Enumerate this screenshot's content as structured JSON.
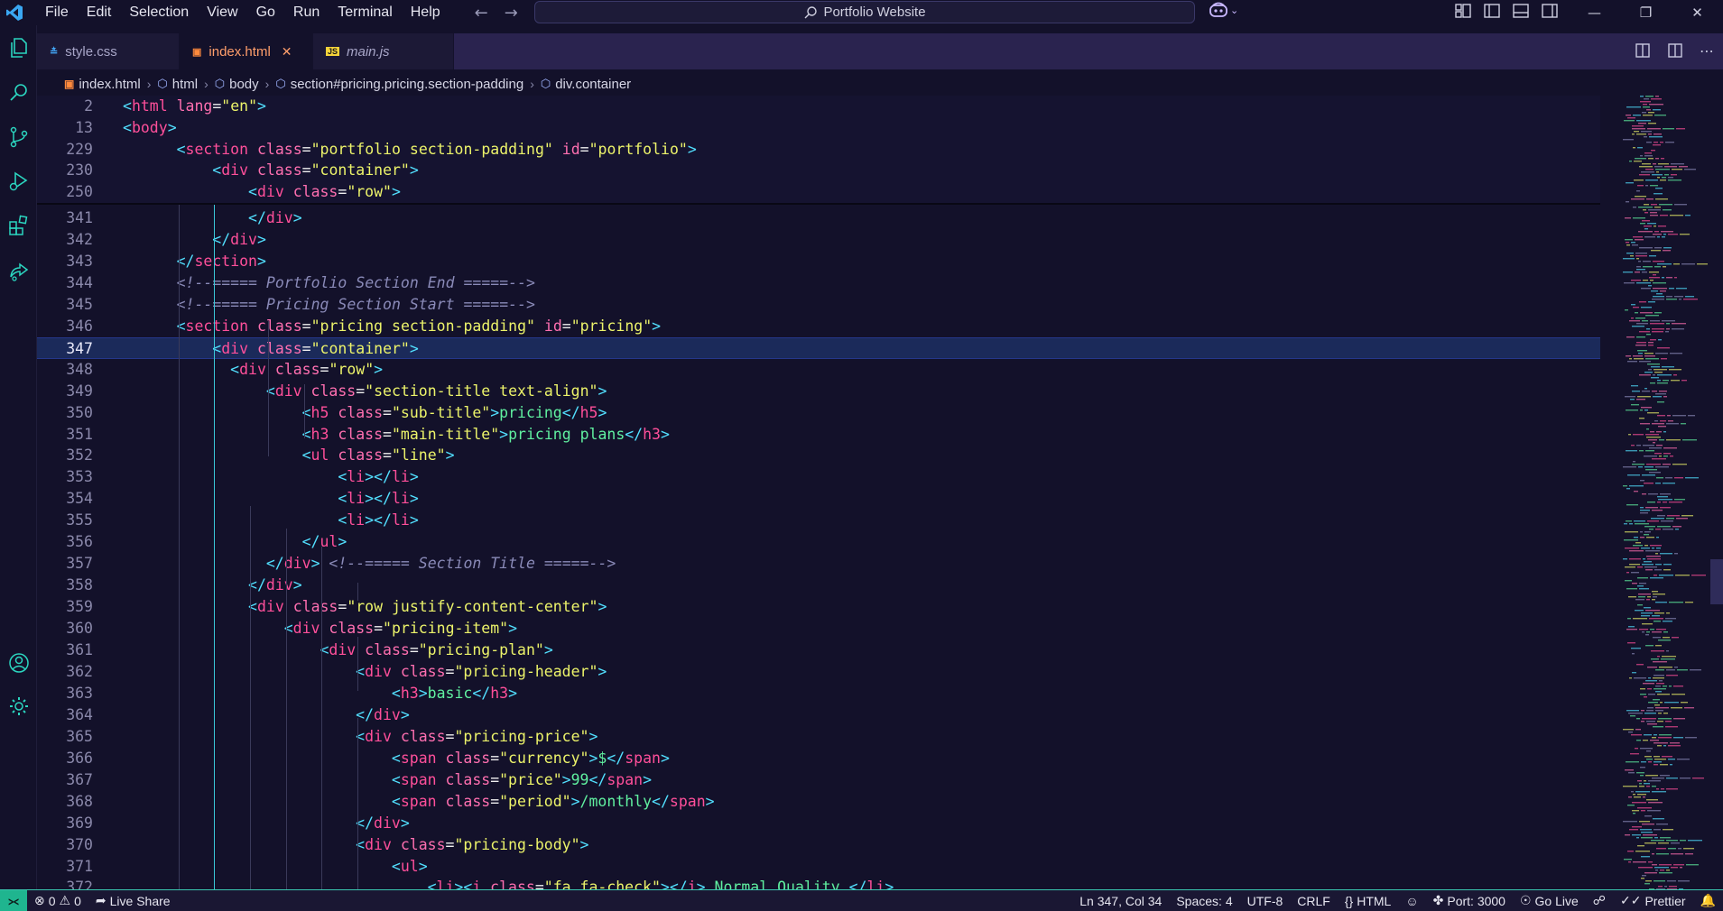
{
  "menu": [
    "File",
    "Edit",
    "Selection",
    "View",
    "Go",
    "Run",
    "Terminal",
    "Help"
  ],
  "command_center": {
    "label": "Portfolio Website"
  },
  "tabs": [
    {
      "label": "style.css",
      "icon": "css-file-icon",
      "active": false,
      "italic": false
    },
    {
      "label": "index.html",
      "icon": "html-file-icon",
      "active": true,
      "italic": false
    },
    {
      "label": "main.js",
      "icon": "js-file-icon",
      "active": false,
      "italic": true
    }
  ],
  "breadcrumb": [
    "index.html",
    "html",
    "body",
    "section#pricing.pricing.section-padding",
    "div.container"
  ],
  "sticky_lines": [
    {
      "n": "2",
      "indent": 0,
      "tokens": [
        [
          "t-punct",
          "<"
        ],
        [
          "t-tag",
          "html"
        ],
        [
          "t-attr",
          " lang"
        ],
        [
          "t-eq",
          "="
        ],
        [
          "t-str",
          "\"en\""
        ],
        [
          "t-punct",
          ">"
        ]
      ]
    },
    {
      "n": "13",
      "indent": 0,
      "tokens": [
        [
          "t-punct",
          "<"
        ],
        [
          "t-tag",
          "body"
        ],
        [
          "t-punct",
          ">"
        ]
      ]
    },
    {
      "n": "229",
      "indent": 6,
      "tokens": [
        [
          "t-punct",
          "<"
        ],
        [
          "t-tag",
          "section"
        ],
        [
          "t-attr",
          " class"
        ],
        [
          "t-eq",
          "="
        ],
        [
          "t-str",
          "\"portfolio section-padding\""
        ],
        [
          "t-attr",
          " id"
        ],
        [
          "t-eq",
          "="
        ],
        [
          "t-str",
          "\"portfolio\""
        ],
        [
          "t-punct",
          ">"
        ]
      ]
    },
    {
      "n": "230",
      "indent": 10,
      "tokens": [
        [
          "t-punct",
          "<"
        ],
        [
          "t-tag",
          "div"
        ],
        [
          "t-attr",
          " class"
        ],
        [
          "t-eq",
          "="
        ],
        [
          "t-str",
          "\"container\""
        ],
        [
          "t-punct",
          ">"
        ]
      ]
    },
    {
      "n": "250",
      "indent": 14,
      "tokens": [
        [
          "t-punct",
          "<"
        ],
        [
          "t-tag",
          "div"
        ],
        [
          "t-attr",
          " class"
        ],
        [
          "t-eq",
          "="
        ],
        [
          "t-str",
          "\"row\""
        ],
        [
          "t-punct",
          ">"
        ]
      ]
    }
  ],
  "lines": [
    {
      "n": "341",
      "indent": 14,
      "tokens": [
        [
          "t-punct",
          "</"
        ],
        [
          "t-tag",
          "div"
        ],
        [
          "t-punct",
          ">"
        ]
      ]
    },
    {
      "n": "342",
      "indent": 10,
      "tokens": [
        [
          "t-punct",
          "</"
        ],
        [
          "t-tag",
          "div"
        ],
        [
          "t-punct",
          ">"
        ]
      ]
    },
    {
      "n": "343",
      "indent": 6,
      "tokens": [
        [
          "t-punct",
          "</"
        ],
        [
          "t-tag",
          "section"
        ],
        [
          "t-punct",
          ">"
        ]
      ]
    },
    {
      "n": "344",
      "indent": 6,
      "tokens": [
        [
          "t-com",
          "<!--===== Portfolio Section End =====-->"
        ]
      ]
    },
    {
      "n": "345",
      "indent": 6,
      "tokens": [
        [
          "t-com",
          "<!--===== Pricing Section Start =====-->"
        ]
      ]
    },
    {
      "n": "346",
      "indent": 6,
      "tokens": [
        [
          "t-punct",
          "<"
        ],
        [
          "t-tag",
          "section"
        ],
        [
          "t-attr",
          " class"
        ],
        [
          "t-eq",
          "="
        ],
        [
          "t-str",
          "\"pricing section-padding\""
        ],
        [
          "t-attr",
          " id"
        ],
        [
          "t-eq",
          "="
        ],
        [
          "t-str",
          "\"pricing\""
        ],
        [
          "t-punct",
          ">"
        ]
      ]
    },
    {
      "n": "347",
      "indent": 10,
      "current": true,
      "tokens": [
        [
          "t-punct",
          "<"
        ],
        [
          "t-tag",
          "div"
        ],
        [
          "t-attr",
          " class"
        ],
        [
          "t-eq",
          "="
        ],
        [
          "t-str",
          "\"container\""
        ],
        [
          "t-punct",
          ">"
        ]
      ]
    },
    {
      "n": "348",
      "indent": 12,
      "tokens": [
        [
          "t-punct",
          "<"
        ],
        [
          "t-tag",
          "div"
        ],
        [
          "t-attr",
          " class"
        ],
        [
          "t-eq",
          "="
        ],
        [
          "t-str",
          "\"row\""
        ],
        [
          "t-punct",
          ">"
        ]
      ]
    },
    {
      "n": "349",
      "indent": 16,
      "tokens": [
        [
          "t-punct",
          "<"
        ],
        [
          "t-tag",
          "div"
        ],
        [
          "t-attr",
          " class"
        ],
        [
          "t-eq",
          "="
        ],
        [
          "t-str",
          "\"section-title text-align\""
        ],
        [
          "t-punct",
          ">"
        ]
      ]
    },
    {
      "n": "350",
      "indent": 20,
      "tokens": [
        [
          "t-punct",
          "<"
        ],
        [
          "t-tag",
          "h5"
        ],
        [
          "t-attr",
          " class"
        ],
        [
          "t-eq",
          "="
        ],
        [
          "t-str",
          "\"sub-title\""
        ],
        [
          "t-punct",
          ">"
        ],
        [
          "t-text",
          "pricing"
        ],
        [
          "t-punct",
          "</"
        ],
        [
          "t-tag",
          "h5"
        ],
        [
          "t-punct",
          ">"
        ]
      ]
    },
    {
      "n": "351",
      "indent": 20,
      "tokens": [
        [
          "t-punct",
          "<"
        ],
        [
          "t-tag",
          "h3"
        ],
        [
          "t-attr",
          " class"
        ],
        [
          "t-eq",
          "="
        ],
        [
          "t-str",
          "\"main-title\""
        ],
        [
          "t-punct",
          ">"
        ],
        [
          "t-text",
          "pricing plans"
        ],
        [
          "t-punct",
          "</"
        ],
        [
          "t-tag",
          "h3"
        ],
        [
          "t-punct",
          ">"
        ]
      ]
    },
    {
      "n": "352",
      "indent": 20,
      "tokens": [
        [
          "t-punct",
          "<"
        ],
        [
          "t-tag",
          "ul"
        ],
        [
          "t-attr",
          " class"
        ],
        [
          "t-eq",
          "="
        ],
        [
          "t-str",
          "\"line\""
        ],
        [
          "t-punct",
          ">"
        ]
      ]
    },
    {
      "n": "353",
      "indent": 24,
      "tokens": [
        [
          "t-punct",
          "<"
        ],
        [
          "t-tag",
          "li"
        ],
        [
          "t-punct",
          "></"
        ],
        [
          "t-tag",
          "li"
        ],
        [
          "t-punct",
          ">"
        ]
      ]
    },
    {
      "n": "354",
      "indent": 24,
      "tokens": [
        [
          "t-punct",
          "<"
        ],
        [
          "t-tag",
          "li"
        ],
        [
          "t-punct",
          "></"
        ],
        [
          "t-tag",
          "li"
        ],
        [
          "t-punct",
          ">"
        ]
      ]
    },
    {
      "n": "355",
      "indent": 24,
      "tokens": [
        [
          "t-punct",
          "<"
        ],
        [
          "t-tag",
          "li"
        ],
        [
          "t-punct",
          "></"
        ],
        [
          "t-tag",
          "li"
        ],
        [
          "t-punct",
          ">"
        ]
      ]
    },
    {
      "n": "356",
      "indent": 20,
      "tokens": [
        [
          "t-punct",
          "</"
        ],
        [
          "t-tag",
          "ul"
        ],
        [
          "t-punct",
          ">"
        ]
      ]
    },
    {
      "n": "357",
      "indent": 16,
      "tokens": [
        [
          "t-punct",
          "</"
        ],
        [
          "t-tag",
          "div"
        ],
        [
          "t-punct",
          ">"
        ],
        [
          "t-com",
          " <!--===== Section Title =====-->"
        ]
      ]
    },
    {
      "n": "358",
      "indent": 14,
      "tokens": [
        [
          "t-punct",
          "</"
        ],
        [
          "t-tag",
          "div"
        ],
        [
          "t-punct",
          ">"
        ]
      ]
    },
    {
      "n": "359",
      "indent": 14,
      "tokens": [
        [
          "t-punct",
          "<"
        ],
        [
          "t-tag",
          "div"
        ],
        [
          "t-attr",
          " class"
        ],
        [
          "t-eq",
          "="
        ],
        [
          "t-str",
          "\"row justify-content-center\""
        ],
        [
          "t-punct",
          ">"
        ]
      ]
    },
    {
      "n": "360",
      "indent": 18,
      "tokens": [
        [
          "t-punct",
          "<"
        ],
        [
          "t-tag",
          "div"
        ],
        [
          "t-attr",
          " class"
        ],
        [
          "t-eq",
          "="
        ],
        [
          "t-str",
          "\"pricing-item\""
        ],
        [
          "t-punct",
          ">"
        ]
      ]
    },
    {
      "n": "361",
      "indent": 22,
      "tokens": [
        [
          "t-punct",
          "<"
        ],
        [
          "t-tag",
          "div"
        ],
        [
          "t-attr",
          " class"
        ],
        [
          "t-eq",
          "="
        ],
        [
          "t-str",
          "\"pricing-plan\""
        ],
        [
          "t-punct",
          ">"
        ]
      ]
    },
    {
      "n": "362",
      "indent": 26,
      "tokens": [
        [
          "t-punct",
          "<"
        ],
        [
          "t-tag",
          "div"
        ],
        [
          "t-attr",
          " class"
        ],
        [
          "t-eq",
          "="
        ],
        [
          "t-str",
          "\"pricing-header\""
        ],
        [
          "t-punct",
          ">"
        ]
      ]
    },
    {
      "n": "363",
      "indent": 30,
      "tokens": [
        [
          "t-punct",
          "<"
        ],
        [
          "t-tag",
          "h3"
        ],
        [
          "t-punct",
          ">"
        ],
        [
          "t-text",
          "basic"
        ],
        [
          "t-punct",
          "</"
        ],
        [
          "t-tag",
          "h3"
        ],
        [
          "t-punct",
          ">"
        ]
      ]
    },
    {
      "n": "364",
      "indent": 26,
      "tokens": [
        [
          "t-punct",
          "</"
        ],
        [
          "t-tag",
          "div"
        ],
        [
          "t-punct",
          ">"
        ]
      ]
    },
    {
      "n": "365",
      "indent": 26,
      "tokens": [
        [
          "t-punct",
          "<"
        ],
        [
          "t-tag",
          "div"
        ],
        [
          "t-attr",
          " class"
        ],
        [
          "t-eq",
          "="
        ],
        [
          "t-str",
          "\"pricing-price\""
        ],
        [
          "t-punct",
          ">"
        ]
      ]
    },
    {
      "n": "366",
      "indent": 30,
      "tokens": [
        [
          "t-punct",
          "<"
        ],
        [
          "t-tag",
          "span"
        ],
        [
          "t-attr",
          " class"
        ],
        [
          "t-eq",
          "="
        ],
        [
          "t-str",
          "\"currency\""
        ],
        [
          "t-punct",
          ">"
        ],
        [
          "t-text",
          "$"
        ],
        [
          "t-punct",
          "</"
        ],
        [
          "t-tag",
          "span"
        ],
        [
          "t-punct",
          ">"
        ]
      ]
    },
    {
      "n": "367",
      "indent": 30,
      "tokens": [
        [
          "t-punct",
          "<"
        ],
        [
          "t-tag",
          "span"
        ],
        [
          "t-attr",
          " class"
        ],
        [
          "t-eq",
          "="
        ],
        [
          "t-str",
          "\"price\""
        ],
        [
          "t-punct",
          ">"
        ],
        [
          "t-text",
          "99"
        ],
        [
          "t-punct",
          "</"
        ],
        [
          "t-tag",
          "span"
        ],
        [
          "t-punct",
          ">"
        ]
      ]
    },
    {
      "n": "368",
      "indent": 30,
      "tokens": [
        [
          "t-punct",
          "<"
        ],
        [
          "t-tag",
          "span"
        ],
        [
          "t-attr",
          " class"
        ],
        [
          "t-eq",
          "="
        ],
        [
          "t-str",
          "\"period\""
        ],
        [
          "t-punct",
          ">"
        ],
        [
          "t-text",
          "/monthly"
        ],
        [
          "t-punct",
          "</"
        ],
        [
          "t-tag",
          "span"
        ],
        [
          "t-punct",
          ">"
        ]
      ]
    },
    {
      "n": "369",
      "indent": 26,
      "tokens": [
        [
          "t-punct",
          "</"
        ],
        [
          "t-tag",
          "div"
        ],
        [
          "t-punct",
          ">"
        ]
      ]
    },
    {
      "n": "370",
      "indent": 26,
      "tokens": [
        [
          "t-punct",
          "<"
        ],
        [
          "t-tag",
          "div"
        ],
        [
          "t-attr",
          " class"
        ],
        [
          "t-eq",
          "="
        ],
        [
          "t-str",
          "\"pricing-body\""
        ],
        [
          "t-punct",
          ">"
        ]
      ]
    },
    {
      "n": "371",
      "indent": 30,
      "tokens": [
        [
          "t-punct",
          "<"
        ],
        [
          "t-tag",
          "ul"
        ],
        [
          "t-punct",
          ">"
        ]
      ]
    },
    {
      "n": "372",
      "indent": 34,
      "tokens": [
        [
          "t-punct",
          "<"
        ],
        [
          "t-tag",
          "li"
        ],
        [
          "t-punct",
          "><"
        ],
        [
          "t-tag",
          "i"
        ],
        [
          "t-attr",
          " class"
        ],
        [
          "t-eq",
          "="
        ],
        [
          "t-str",
          "\"fa fa-check\""
        ],
        [
          "t-punct",
          "></"
        ],
        [
          "t-tag",
          "i"
        ],
        [
          "t-punct",
          ">"
        ],
        [
          "t-text",
          " Normal Quality "
        ],
        [
          "t-punct",
          "</"
        ],
        [
          "t-tag",
          "li"
        ],
        [
          "t-punct",
          ">"
        ]
      ]
    }
  ],
  "status": {
    "remote_icon": "remote-icon",
    "errors": "0",
    "warnings": "0",
    "live_share": "Live Share",
    "cursor": "Ln 347, Col 34",
    "spaces": "Spaces: 4",
    "encoding": "UTF-8",
    "eol": "CRLF",
    "language": "HTML",
    "port": "Port: 3000",
    "go_live": "Go Live",
    "prettier": "Prettier"
  }
}
